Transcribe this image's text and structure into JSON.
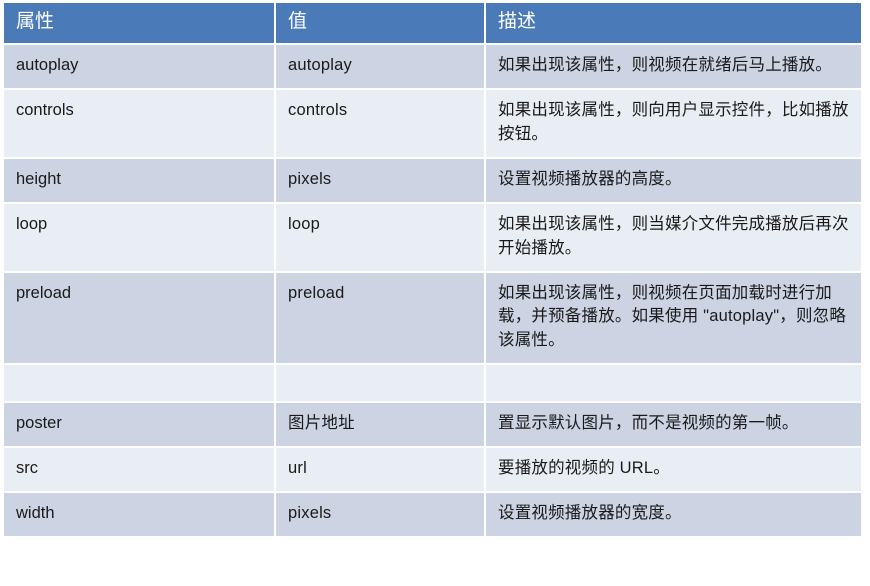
{
  "table": {
    "name": "html5-video-attributes-table",
    "columns": [
      "属性",
      "值",
      "描述"
    ],
    "header_bg": "#4a7ab8",
    "header_color": "#ffffff",
    "row_bg_dark": "#ccd3e3",
    "row_bg_light": "#e9edf4",
    "rows": [
      {
        "attribute": "autoplay",
        "value": "autoplay",
        "description": "如果出现该属性，则视频在就绪后马上播放。"
      },
      {
        "attribute": "controls",
        "value": "controls",
        "description": "如果出现该属性，则向用户显示控件，比如播放按钮。"
      },
      {
        "attribute": "height",
        "value": "pixels",
        "description": "设置视频播放器的高度。"
      },
      {
        "attribute": "loop",
        "value": "loop",
        "description": "如果出现该属性，则当媒介文件完成播放后再次开始播放。"
      },
      {
        "attribute": "preload",
        "value": "preload",
        "description": "如果出现该属性，则视频在页面加载时进行加载，并预备播放。如果使用 \"autoplay\"，则忽略该属性。"
      },
      {
        "attribute": "",
        "value": "",
        "description": ""
      },
      {
        "attribute": "poster",
        "value": "图片地址",
        "description": "置显示默认图片，而不是视频的第一帧。"
      },
      {
        "attribute": "src",
        "value": "url",
        "description": "要播放的视频的 URL。"
      },
      {
        "attribute": "width",
        "value": "pixels",
        "description": "设置视频播放器的宽度。"
      }
    ]
  }
}
